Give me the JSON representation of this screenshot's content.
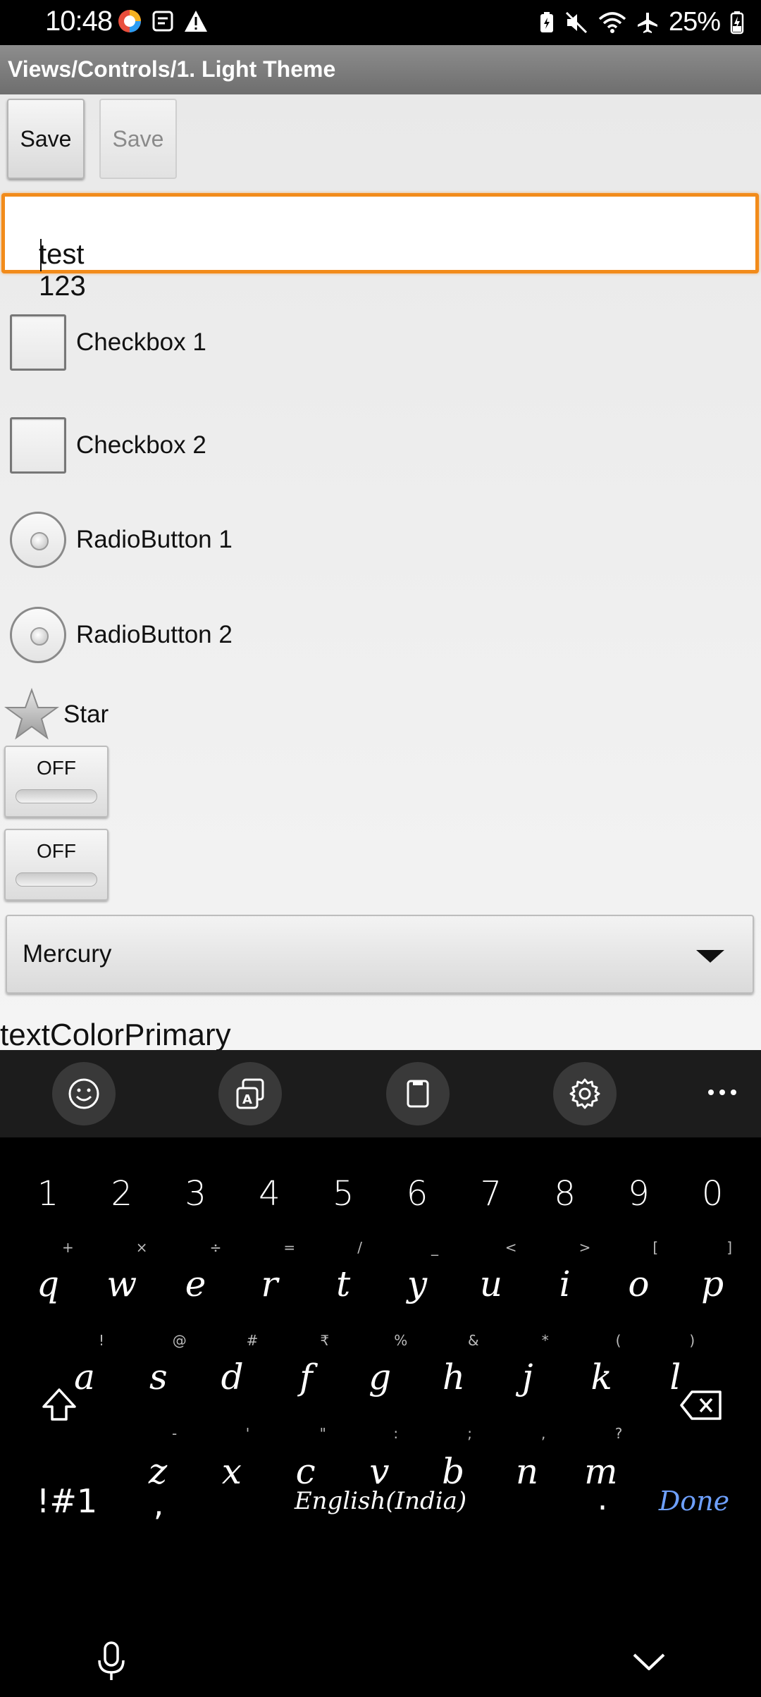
{
  "status_bar": {
    "time": "10:48",
    "battery_text": "25%"
  },
  "title_bar": {
    "title": "Views/Controls/1. Light Theme"
  },
  "buttons": {
    "save_enabled": "Save",
    "save_disabled": "Save"
  },
  "text_field": {
    "value": "test 123"
  },
  "checkboxes": [
    {
      "label": "Checkbox 1",
      "checked": false
    },
    {
      "label": "Checkbox 2",
      "checked": false
    }
  ],
  "radios": [
    {
      "label": "RadioButton 1",
      "selected": false
    },
    {
      "label": "RadioButton 2",
      "selected": false
    }
  ],
  "star": {
    "label": "Star"
  },
  "toggles": [
    {
      "label": "OFF"
    },
    {
      "label": "OFF"
    }
  ],
  "spinner": {
    "selected": "Mercury"
  },
  "text_color_label": "textColorPrimary",
  "keyboard": {
    "numbers": [
      "1",
      "2",
      "3",
      "4",
      "5",
      "6",
      "7",
      "8",
      "9",
      "0"
    ],
    "row1": {
      "keys": [
        "q",
        "w",
        "e",
        "r",
        "t",
        "y",
        "u",
        "i",
        "o",
        "p"
      ],
      "hints": [
        "+",
        "×",
        "÷",
        "=",
        "/",
        "_",
        "<",
        ">",
        "[",
        "]"
      ]
    },
    "row2": {
      "keys": [
        "a",
        "s",
        "d",
        "f",
        "g",
        "h",
        "j",
        "k",
        "l"
      ],
      "hints": [
        "!",
        "@",
        "#",
        "₹",
        "%",
        "&",
        "*",
        "(",
        ")"
      ]
    },
    "row3": {
      "keys": [
        "z",
        "x",
        "c",
        "v",
        "b",
        "n",
        "m"
      ],
      "hints": [
        "-",
        "'",
        "\"",
        ":",
        ";",
        ",",
        "?"
      ]
    },
    "symbols_key": "!#1",
    "comma_key": ",",
    "space_label": "English(India)",
    "period_key": ".",
    "done_key": "Done"
  },
  "colors": {
    "accent_orange": "#f28b1a",
    "done_blue": "#6ea0ff"
  }
}
